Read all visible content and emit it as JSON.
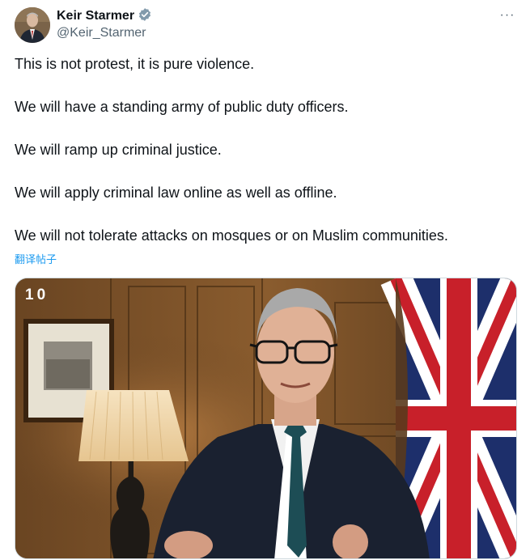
{
  "author": {
    "display_name": "Keir Starmer",
    "handle": "@Keir_Starmer",
    "verified_icon": "verified-badge-icon",
    "colors": {
      "verified": "#829aab"
    }
  },
  "menu": {
    "more_label": "···",
    "icon": "more-horizontal-icon"
  },
  "post": {
    "lines": [
      "This is not protest, it is pure violence.",
      "We will have a standing army of public duty officers.",
      "We will ramp up criminal justice.",
      "We will apply criminal law online as well as offline.",
      "We will not tolerate attacks on mosques or on Muslim communities."
    ]
  },
  "translate_label": "翻译帖子",
  "media": {
    "watermark": "10",
    "description_icon": "video-thumbnail"
  },
  "colors": {
    "link": "#1d9bf0",
    "secondary": "#536471",
    "text": "#0f1419"
  }
}
